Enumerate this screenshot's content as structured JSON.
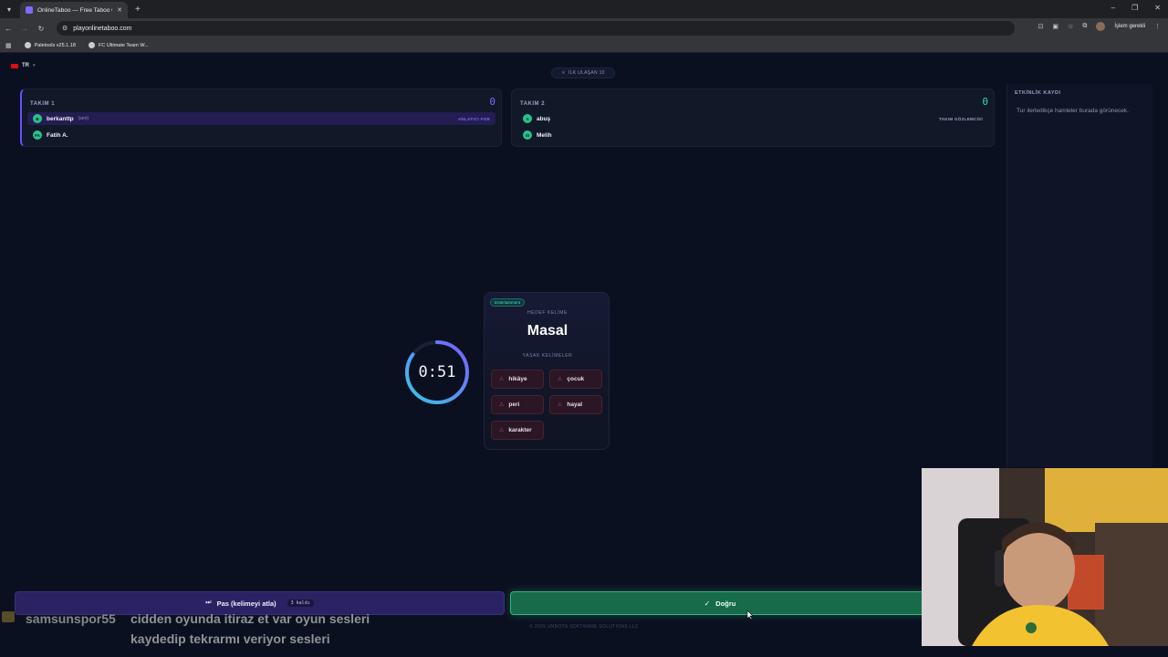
{
  "browser": {
    "tab_title": "OnlineTaboo — Free Taboo Ga...",
    "url": "playonlinetaboo.com",
    "pending_label": "İşlem gerekli",
    "bookmarks": [
      "Paletools v25.1.18",
      "FC Ultimate Team W..."
    ]
  },
  "header": {
    "language": "TR",
    "goal_label": "İLK ULAŞAN 10"
  },
  "teams": [
    {
      "title": "TAKIM 1",
      "score": "0",
      "players": [
        {
          "initial": "B",
          "name": "berkanttp",
          "suffix": "(sen)",
          "role": "ANLATICI FOR"
        },
        {
          "initial": "FA",
          "name": "Fatih A.",
          "suffix": "",
          "role": ""
        }
      ]
    },
    {
      "title": "TAKIM 2",
      "score": "0",
      "players": [
        {
          "initial": "A",
          "name": "abuş",
          "suffix": "",
          "role": "TAKIM GÖZLEMCİSİ"
        },
        {
          "initial": "M",
          "name": "Melih",
          "suffix": "",
          "role": ""
        }
      ]
    }
  ],
  "activity_log": {
    "title": "ETKİNLİK KAYDI",
    "empty_text": "Tur ilerledikçe hamleler burada görünecek."
  },
  "timer": {
    "text": "0:51",
    "fraction_remaining": 0.85
  },
  "card": {
    "category": "Entertainment",
    "target_label": "HEDEF KELİME",
    "target_word": "Masal",
    "forbidden_label": "YASAK KELİMELER",
    "forbidden_words": [
      "hikâye",
      "çocuk",
      "peri",
      "hayal",
      "karakter"
    ]
  },
  "actions": {
    "pass_label": "Pas (kelimeyi atla)",
    "pass_count": "3 kaldı",
    "correct_label": "Doğru"
  },
  "footer": "© 2025 UNBOTS SOFTWARE SOLUTIONS LLC",
  "chat": {
    "user": "samsunspor55",
    "message_line1": "cidden oyunda itiraz et var oyun sesleri",
    "message_line2": "kaydedip tekrarmı veriyor sesleri"
  },
  "colors": {
    "accent_purple": "#6d4cff",
    "accent_teal": "#2fd6b8",
    "correct_green": "#176b4a",
    "forbidden_red": "#c3485a"
  }
}
